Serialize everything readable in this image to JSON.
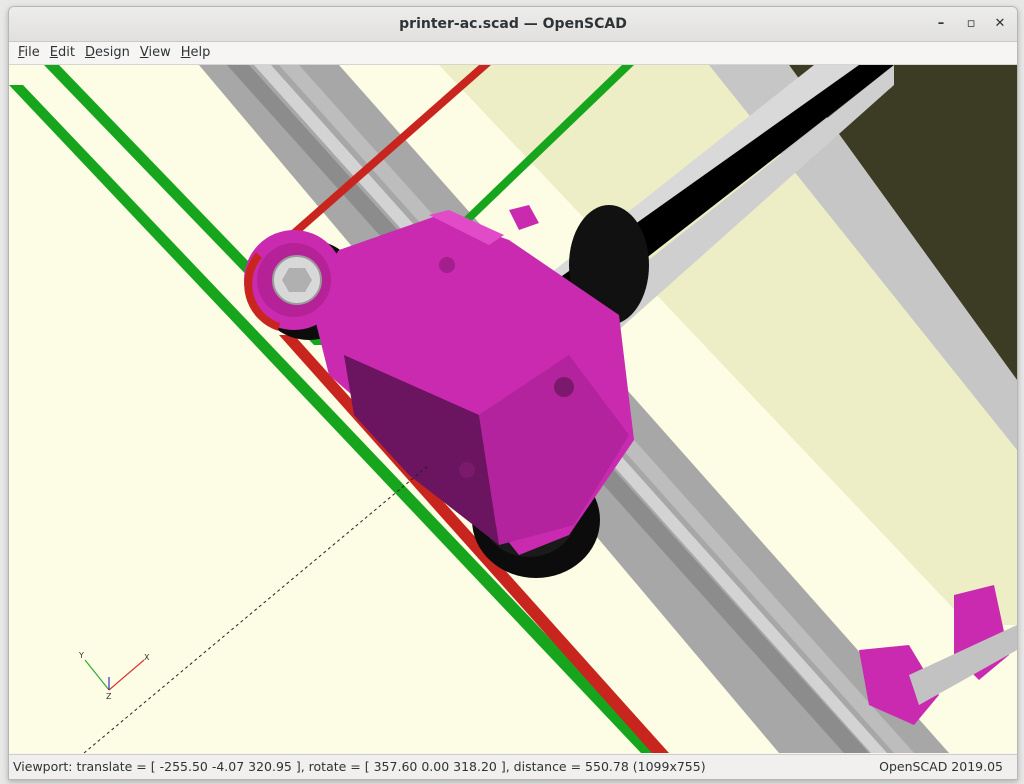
{
  "window": {
    "title": "printer-ac.scad — OpenSCAD",
    "controls": {
      "minimize": "–",
      "maximize": "▫",
      "close": "✕"
    }
  },
  "menu": {
    "items": [
      {
        "label": "File",
        "mnemonic": "F",
        "rest": "ile"
      },
      {
        "label": "Edit",
        "mnemonic": "E",
        "rest": "dit"
      },
      {
        "label": "Design",
        "mnemonic": "D",
        "rest": "esign"
      },
      {
        "label": "View",
        "mnemonic": "V",
        "rest": "iew"
      },
      {
        "label": "Help",
        "mnemonic": "H",
        "rest": "elp"
      }
    ]
  },
  "viewport": {
    "axes_labels": {
      "x": "X",
      "y": "Y",
      "z": "Z"
    },
    "colors": {
      "background": "#fdfde5",
      "part": "#c92ab0",
      "extrusion": "#a9a9a9",
      "belt_green": "#17a51d",
      "belt_red": "#c8251f",
      "panel_dark": "#3b3a24"
    }
  },
  "status": {
    "viewport": "Viewport: translate = [ -255.50 -4.07 320.95 ], rotate = [ 357.60 0.00 318.20 ], distance = 550.78 (1099x755)",
    "version": "OpenSCAD 2019.05"
  }
}
